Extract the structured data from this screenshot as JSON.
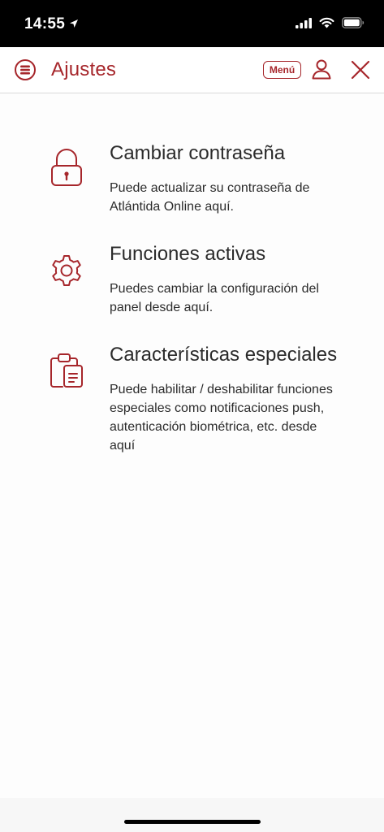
{
  "status_bar": {
    "time": "14:55",
    "icons": [
      "location-arrow-icon",
      "signal-icon",
      "wifi-icon",
      "battery-icon"
    ]
  },
  "header": {
    "title": "Ajustes",
    "menu_label": "Menú",
    "icons": [
      "app-logo-icon",
      "user-icon",
      "close-icon"
    ]
  },
  "settings": [
    {
      "icon": "lock-icon",
      "title": "Cambiar contraseña",
      "description": "Puede actualizar su contraseña de Atlántida Online aquí."
    },
    {
      "icon": "gear-icon",
      "title": "Funciones activas",
      "description": "Puedes cambiar la configuración del panel desde aquí."
    },
    {
      "icon": "clipboard-icon",
      "title": "Características especiales",
      "description": "Puede habilitar / deshabilitar funciones especiales como notificaciones push, autenticación biométrica, etc. desde aquí"
    }
  ],
  "colors": {
    "accent": "#a6262b",
    "text": "#2b2b2b",
    "status_bar_bg": "#000000",
    "divider": "#d9d9d9"
  }
}
